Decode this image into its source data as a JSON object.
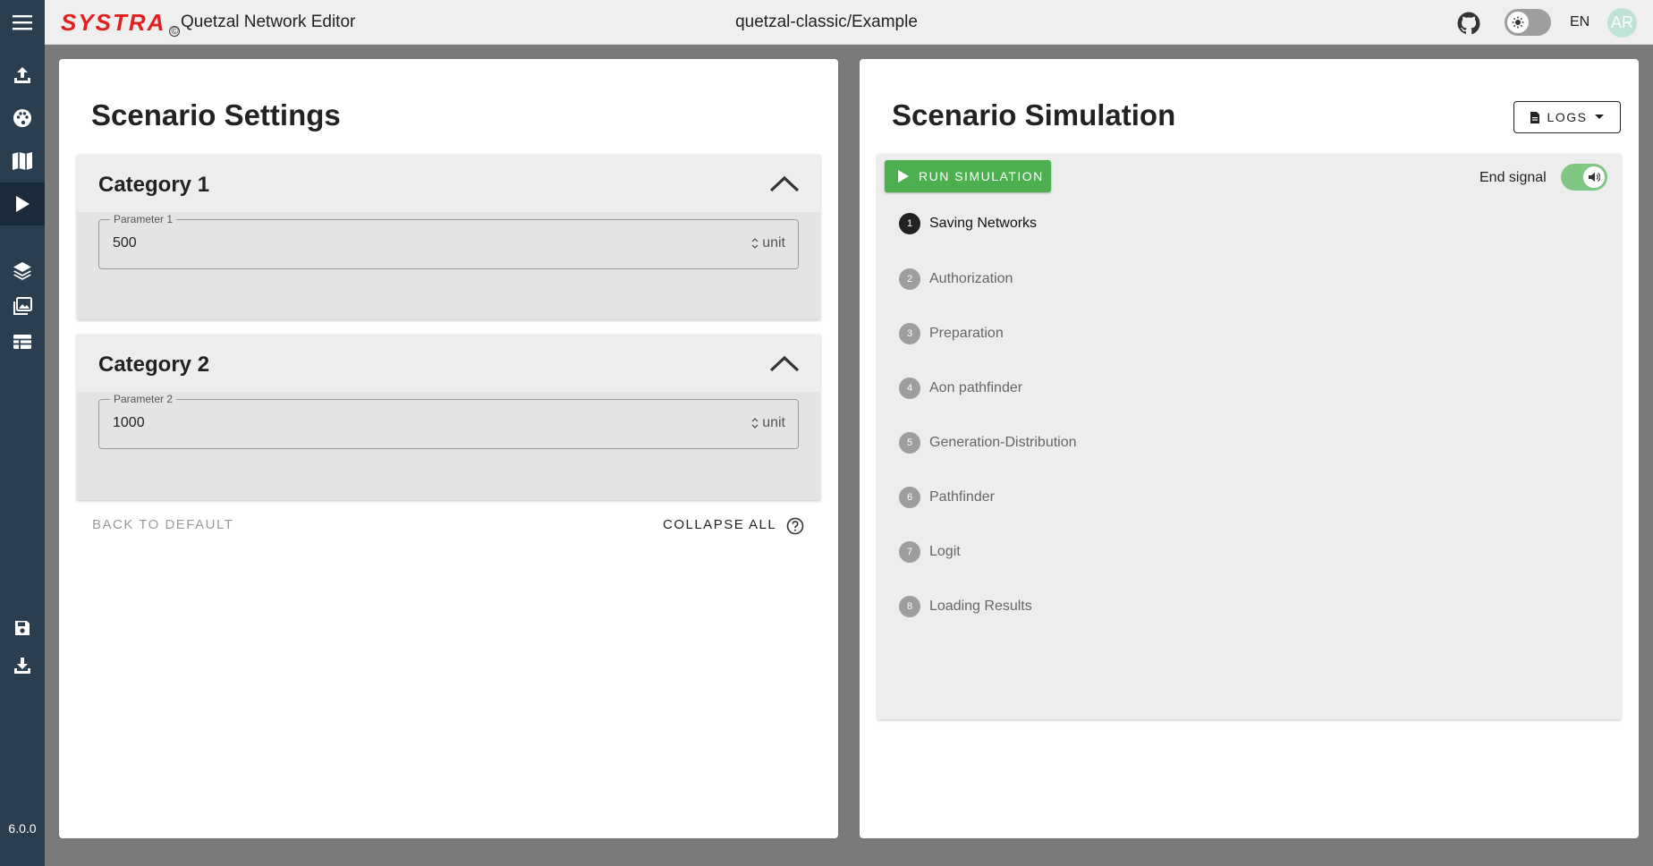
{
  "header": {
    "logo_text": "SYSTRA",
    "logo_mark": "©",
    "app_title": "Quetzal Network Editor",
    "project": "quetzal-classic/Example",
    "language": "EN",
    "avatar_initials": "AR"
  },
  "sidebar": {
    "items": [
      {
        "icon": "upload-icon"
      },
      {
        "icon": "palette-icon"
      },
      {
        "icon": "map-icon"
      },
      {
        "icon": "play-icon",
        "active": true
      },
      {
        "icon": "layers-icon"
      },
      {
        "icon": "image-stack-icon"
      },
      {
        "icon": "table-icon"
      },
      {
        "icon": "save-icon"
      },
      {
        "icon": "download-icon"
      }
    ],
    "version": "6.0.0"
  },
  "settings": {
    "title": "Scenario Settings",
    "categories": [
      {
        "title": "Category 1",
        "param_label": "Parameter 1",
        "value": "500",
        "unit": "unit"
      },
      {
        "title": "Category 2",
        "param_label": "Parameter 2",
        "value": "1000",
        "unit": "unit"
      }
    ],
    "back_to_default": "BACK TO DEFAULT",
    "collapse_all": "COLLAPSE ALL"
  },
  "simulation": {
    "title": "Scenario Simulation",
    "logs_label": "LOGS",
    "run_label": "RUN SIMULATION",
    "end_signal_label": "End signal",
    "end_signal_on": true,
    "steps": [
      {
        "num": "1",
        "label": "Saving Networks",
        "active": true
      },
      {
        "num": "2",
        "label": "Authorization"
      },
      {
        "num": "3",
        "label": "Preparation"
      },
      {
        "num": "4",
        "label": "Aon pathfinder"
      },
      {
        "num": "5",
        "label": "Generation-Distribution"
      },
      {
        "num": "6",
        "label": "Pathfinder"
      },
      {
        "num": "7",
        "label": "Logit"
      },
      {
        "num": "8",
        "label": "Loading Results"
      }
    ]
  },
  "colors": {
    "sidebar": "#2b3e50",
    "run_button": "#4caf50",
    "logo": "#e0211f"
  }
}
